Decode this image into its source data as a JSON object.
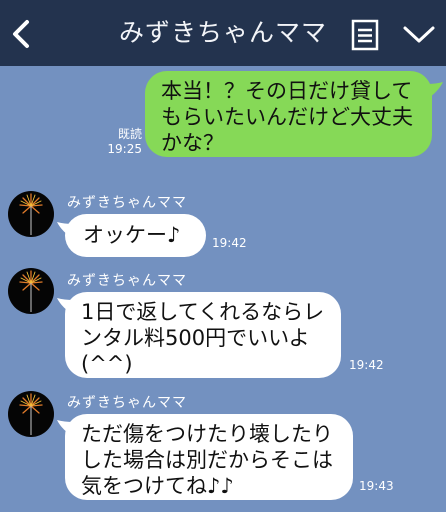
{
  "header": {
    "title": "みずきちゃんママ"
  },
  "messages": [
    {
      "direction": "outgoing",
      "text": "本当！？その日だけ貸してもらいたいんだけど大丈夫かな？",
      "read_label": "既読",
      "time": "19:25"
    },
    {
      "direction": "incoming",
      "sender": "みずきちゃんママ",
      "text": "オッケー♪",
      "time": "19:42"
    },
    {
      "direction": "incoming",
      "sender": "みずきちゃんママ",
      "text": "1日で返してくれるならレンタル料500円でいいよ(^^)",
      "time": "19:42"
    },
    {
      "direction": "incoming",
      "sender": "みずきちゃんママ",
      "text": "ただ傷をつけたり壊したりした場合は別だからそこは気をつけてね♪♪",
      "time": "19:43"
    }
  ],
  "colors": {
    "header_bg": "#23334e",
    "chat_bg": "#7391c0",
    "outgoing_bubble": "#86d957",
    "incoming_bubble": "#ffffff"
  },
  "icons": {
    "back": "back-chevron-icon",
    "note": "note-list-icon",
    "menu": "chevron-down-icon",
    "avatar": "fireworks-avatar"
  }
}
